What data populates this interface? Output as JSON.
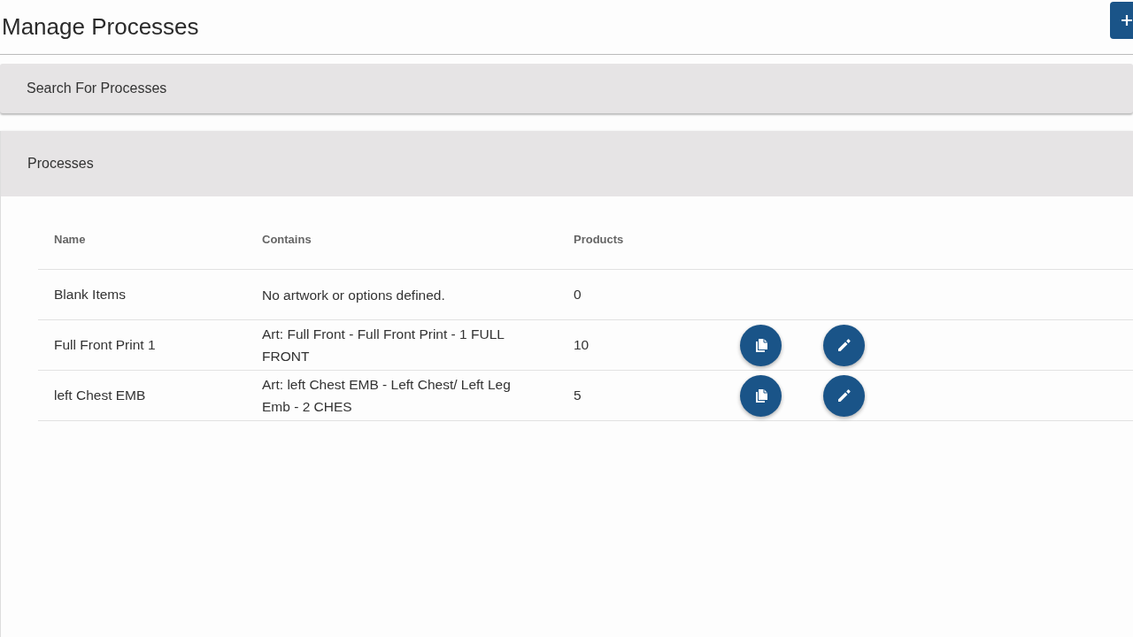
{
  "page": {
    "title": "Manage Processes"
  },
  "search_panel": {
    "title": "Search For Processes"
  },
  "processes_panel": {
    "title": "Processes",
    "table": {
      "columns": [
        "Name",
        "Contains",
        "Products"
      ],
      "rows": [
        {
          "name": "Blank Items",
          "contains": "No artwork or options defined.",
          "products": "0",
          "has_actions": false
        },
        {
          "name": "Full Front Print 1",
          "contains": "Art: Full Front - Full Front Print - 1 FULL FRONT",
          "products": "10",
          "has_actions": true
        },
        {
          "name": "left Chest EMB",
          "contains": "Art: left Chest EMB - Left Chest/ Left Leg Emb - 2 CHES",
          "products": "5",
          "has_actions": true
        }
      ]
    }
  }
}
